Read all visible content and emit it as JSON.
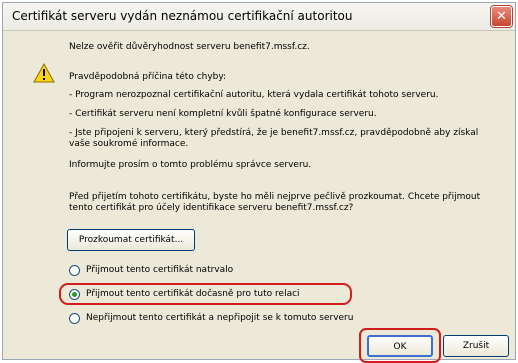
{
  "dialog": {
    "title": "Certifikát serveru vydán neznámou certifikační autoritou",
    "close_label": "✕"
  },
  "body": {
    "line1": "Nelze ověřit důvěryhodnost serveru benefit7.mssf.cz.",
    "line2": "Pravděpodobná příčina této chyby:",
    "bullet1": "- Program nerozpoznal certifikační autoritu, která vydala certifikát tohoto serveru.",
    "bullet2": "- Certifikát serveru není kompletní kvůli špatné konfigurace serveru.",
    "bullet3a": "- Jste připojeni k serveru, který předstírá, že je benefit7.mssf.cz, pravděpodobně aby získal",
    "bullet3b": "vaše soukromé informace.",
    "inform": "Informujte prosím o tomto problému správce serveru.",
    "before_a": "Před přijetím tohoto certifikátu, byste ho měli nejprve pečlivě prozkoumat. Chcete přijmout",
    "before_b": "tento certifikát pro účely identifikace serveru benefit7.mssf.cz?"
  },
  "examine_button": "Prozkoumat certifikát...",
  "options": {
    "permanent": "Přijmout tento certifikát natrvalo",
    "temporary": "Přijmout tento certifikát dočasně pro tuto relaci",
    "reject": "Nepřijmout tento certifikát a nepřipojit se k tomuto serveru",
    "selected": "temporary"
  },
  "buttons": {
    "ok": "OK",
    "cancel": "Zrušit"
  },
  "colors": {
    "highlight": "#d31d1d",
    "dialog_bg": "#ece9d8",
    "radio_selected": "#21a121"
  }
}
